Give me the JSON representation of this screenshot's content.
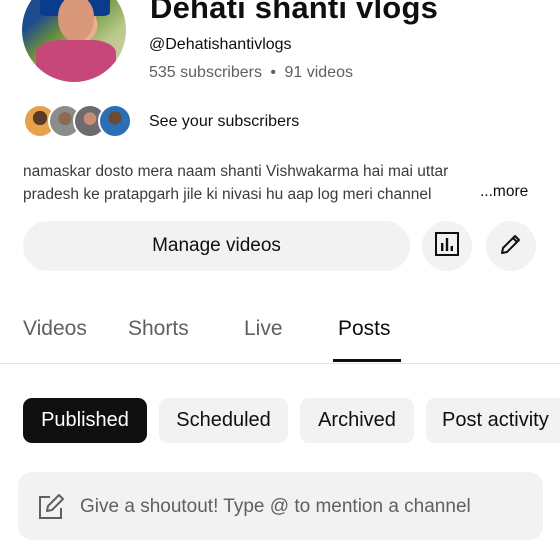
{
  "channel": {
    "title": "Dehati shanti vlogs",
    "handle": "@Dehatishantivlogs",
    "subscribers": "535 subscribers",
    "separator": "•",
    "videos": "91 videos",
    "see_subscribers": "See your subscribers",
    "description_line1": "namaskar dosto mera naam shanti Vishwakarma hai mai uttar",
    "description_line2": "pradesh ke pratapgarh  jile ki nivasi hu  aap log meri channel",
    "more_label": "...more"
  },
  "actions": {
    "manage_videos": "Manage videos",
    "analytics_icon": "analytics-icon",
    "edit_icon": "pencil-icon"
  },
  "tabs": [
    {
      "label": "Videos",
      "active": false
    },
    {
      "label": "Shorts",
      "active": false
    },
    {
      "label": "Live",
      "active": false
    },
    {
      "label": "Posts",
      "active": true
    }
  ],
  "chips": [
    {
      "label": "Published",
      "selected": true
    },
    {
      "label": "Scheduled",
      "selected": false
    },
    {
      "label": "Archived",
      "selected": false
    },
    {
      "label": "Post activity",
      "selected": false
    }
  ],
  "composer": {
    "placeholder": "Give a shoutout! Type @ to mention a channel",
    "icon": "edit-post-icon"
  },
  "colors": {
    "selected_chip_bg": "#0f0f0f",
    "chip_bg": "#f2f2f2",
    "secondary_text": "#606060"
  }
}
